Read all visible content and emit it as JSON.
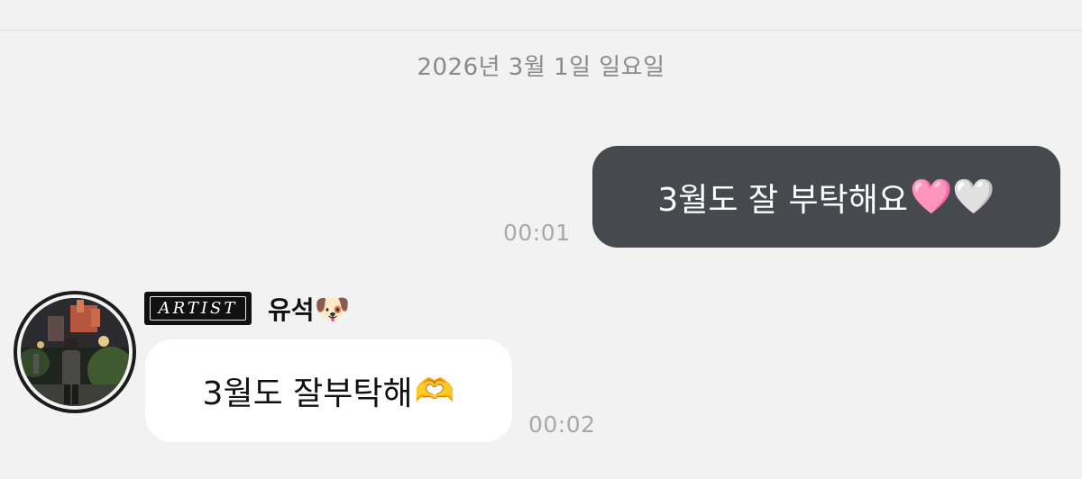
{
  "date_separator": "2026년 3월 1일 일요일",
  "outgoing_message": {
    "text": "3월도 잘 부탁해요",
    "emoji": "🩷🤍",
    "time": "00:01"
  },
  "incoming_message": {
    "badge": "ARTIST",
    "sender_name": "유석",
    "sender_emoji": "🐶",
    "text": "3월도 잘부탁해",
    "emoji": "🫶",
    "time": "00:02"
  },
  "colors": {
    "background": "#f2f2f2",
    "outgoing_bubble": "#464a4f",
    "incoming_bubble": "#ffffff",
    "timestamp": "#a8a8a8",
    "date_text": "#8a8a8a",
    "badge_bg": "#111111"
  }
}
